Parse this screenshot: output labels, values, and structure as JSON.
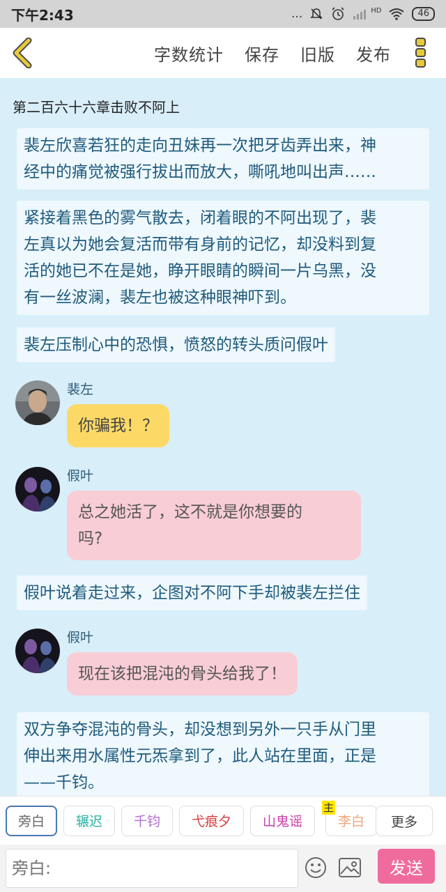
{
  "status_bar": {
    "time": "下午2:43",
    "dots": "...",
    "network": "HD",
    "battery": "46"
  },
  "toolbar": {
    "back_icon": "chevron-left-icon",
    "actions": [
      "字数统计",
      "保存",
      "旧版",
      "发布"
    ],
    "more_icon": "vertical-dots-icon",
    "accent": "#e7c93a"
  },
  "chapter": {
    "title": "第二百六十六章击败不阿上"
  },
  "messages": [
    {
      "type": "narration",
      "lines": [
        "裴左欣喜若狂的走向丑妹再一次把牙齿弄出来，神",
        "经中的痛觉被强行拔出而放大，嘶吼地叫出声……"
      ]
    },
    {
      "type": "narration",
      "lines": [
        "紧接着黑色的雾气散去，闭着眼的不阿出现了，裴",
        "左真以为她会复活而带有身前的记忆，却没料到复",
        "活的她已不在是她，睁开眼睛的瞬间一片乌黑，没",
        "有一丝波澜，裴左也被这种眼神吓到。"
      ]
    },
    {
      "type": "narration",
      "lines": [
        "裴左压制心中的恐惧，愤怒的转头质问假叶"
      ]
    },
    {
      "type": "dialog",
      "speaker": "裴左",
      "lines": [
        "你骗我！？"
      ]
    },
    {
      "type": "dialog",
      "speaker": "假叶",
      "lines": [
        "总之她活了，这不就是你想要的",
        "吗?"
      ]
    },
    {
      "type": "narration",
      "lines": [
        "假叶说着走过来，企图对不阿下手却被裴左拦住"
      ]
    },
    {
      "type": "dialog",
      "speaker": "假叶",
      "lines": [
        "现在该把混沌的骨头给我了！"
      ]
    },
    {
      "type": "narration",
      "lines": [
        "双方争夺混沌的骨头，却没想到另外一只手从门里",
        "伸出来用水属性元炁拿到了，此人站在里面，正是",
        "——千钧。"
      ]
    }
  ],
  "characters": [
    {
      "label": "旁白",
      "color": "#666666"
    },
    {
      "label": "辗迟",
      "color": "#2bb3a3"
    },
    {
      "label": "千钧",
      "color": "#b36bd1"
    },
    {
      "label": "弋痕夕",
      "color": "#d93c3c"
    },
    {
      "label": "山鬼谣",
      "color": "#c93fa6"
    },
    {
      "label": "李白",
      "color": "#f0a57a",
      "badge": "主"
    }
  ],
  "more_characters": "更多",
  "input": {
    "placeholder": "旁白:",
    "emoji_icon": "smiley-icon",
    "image_icon": "image-icon",
    "send_label": "发送",
    "send_color": "#f06b9d"
  }
}
